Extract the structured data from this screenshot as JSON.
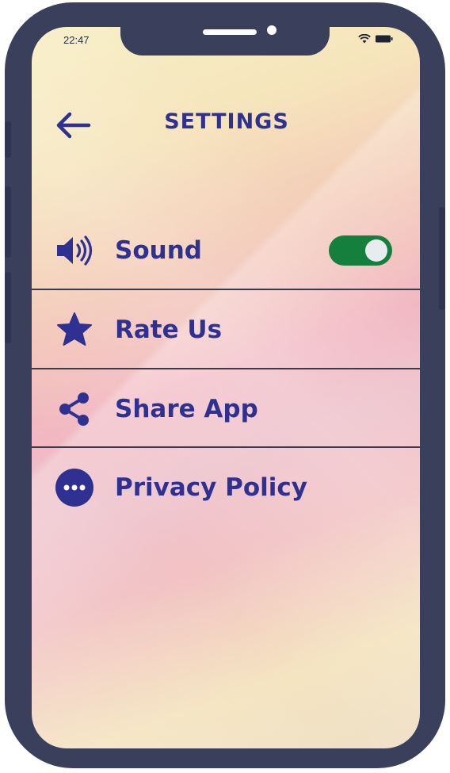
{
  "status_bar": {
    "time": "22:47",
    "wifi_icon": "wifi-icon",
    "battery_icon": "battery-icon"
  },
  "header": {
    "back_icon": "arrow-left-icon",
    "title": "SETTINGS"
  },
  "settings": {
    "items": [
      {
        "icon": "speaker-icon",
        "label": "Sound",
        "toggle": {
          "on": true
        }
      },
      {
        "icon": "star-icon",
        "label": "Rate Us"
      },
      {
        "icon": "share-icon",
        "label": "Share App"
      },
      {
        "icon": "more-dots-icon",
        "label": "Privacy Policy"
      }
    ]
  },
  "colors": {
    "accent": "#2e3192",
    "toggle_on": "#15803d",
    "frame": "#3a3f5b"
  }
}
